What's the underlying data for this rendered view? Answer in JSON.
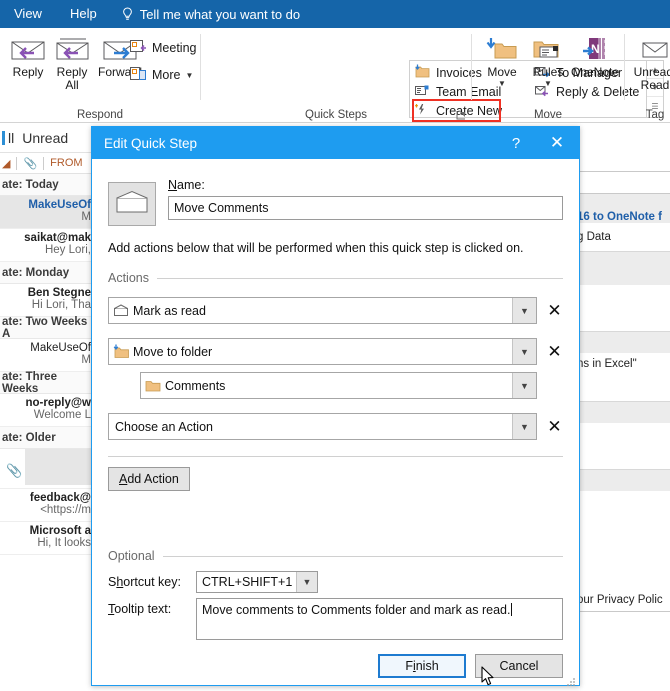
{
  "ribbon": {
    "tabs": [
      {
        "label": "View"
      },
      {
        "label": "Help"
      }
    ],
    "tellme": {
      "icon": "lightbulb-icon",
      "label": "Tell me what you want to do"
    },
    "groups": [
      {
        "name": "Respond",
        "label": "Respond"
      },
      {
        "name": "Quick Steps",
        "label": "Quick Steps"
      },
      {
        "name": "Move",
        "label": "Move"
      },
      {
        "name": "Tags",
        "label": "Tag"
      }
    ],
    "respond": {
      "reply": "Reply",
      "reply_all_line1": "Reply",
      "reply_all_line2": "All",
      "forward": "Forward",
      "meeting": "Meeting",
      "more": "More"
    },
    "quick_steps": {
      "items": [
        {
          "label": "Invoices",
          "icon": "move-folder-icon"
        },
        {
          "label": "To Manager",
          "icon": "forward-mail-icon"
        },
        {
          "label": "Team Email",
          "icon": "new-email-icon"
        },
        {
          "label": "Reply & Delete",
          "icon": "reply-delete-icon"
        },
        {
          "label": "Create New",
          "icon": "create-new-icon"
        }
      ],
      "highlighted": "Create New"
    },
    "move": {
      "move": "Move",
      "rules": "Rules",
      "onenote": "OneNote"
    },
    "tags": {
      "unread_line1": "Unread/",
      "unread_line2": "Read"
    }
  },
  "mail_list": {
    "toolbar": {
      "all": "ll",
      "unread": "Unread"
    },
    "columns": {
      "from": "FROM",
      "attachment_icon": "paperclip-icon",
      "sort_icon": "sort-icon"
    },
    "groups": [
      {
        "header": "ate: Today",
        "rows": [
          {
            "from": "MakeUseOf",
            "preview": "M",
            "selected": true,
            "blue": true
          },
          {
            "from": "saikat@mak",
            "preview": "Hey Lori,",
            "selected": false,
            "blue": false
          }
        ]
      },
      {
        "header": "ate: Monday",
        "rows": [
          {
            "from": "Ben Stegne",
            "preview": "Hi Lori,  Tha",
            "selected": false,
            "blue": false
          }
        ]
      },
      {
        "header": "ate: Two Weeks A",
        "rows": [
          {
            "from": "MakeUseOf",
            "preview": "M",
            "selected": false,
            "blue": false
          }
        ]
      },
      {
        "header": "ate: Three Weeks",
        "rows": [
          {
            "from": "no-reply@w",
            "preview": "Welcome L",
            "selected": false,
            "blue": false
          }
        ]
      },
      {
        "header": "ate: Older",
        "rows": [
          {
            "from": "feedback@",
            "preview": "<https://m",
            "selected": false,
            "blue": false
          },
          {
            "from": "Microsoft a",
            "preview": "Hi,  It looks",
            "selected": false,
            "blue": false
          }
        ]
      }
    ]
  },
  "reading_pane": {
    "lines": [
      {
        "text": "16 to OneNote f",
        "blue": true
      },
      {
        "text": "g Data",
        "blue": false
      },
      {
        "text": "ns in Excel\"",
        "blue": false
      },
      {
        "text": "our Privacy Polic",
        "blue": false
      }
    ]
  },
  "dialog": {
    "title": "Edit Quick Step",
    "help_button": "?",
    "close_button": "✕",
    "icon": "envelope-icon",
    "name_label": "Name:",
    "name_value": "Move Comments",
    "hint": "Add actions below that will be performed when this quick step is clicked on.",
    "actions_legend": "Actions",
    "actions": [
      {
        "label": "Mark as read",
        "icon": "mark-read-icon",
        "has_remove": true,
        "sub": null
      },
      {
        "label": "Move to folder",
        "icon": "move-folder-icon",
        "has_remove": true,
        "sub": {
          "label": "Comments",
          "icon": "folder-icon"
        }
      },
      {
        "label": "Choose an Action",
        "icon": null,
        "has_remove": true,
        "sub": null
      }
    ],
    "add_action_button": "Add Action",
    "optional_legend": "Optional",
    "shortcut_label": "Shortcut key:",
    "shortcut_value": "CTRL+SHIFT+1",
    "tooltip_label": "Tooltip text:",
    "tooltip_value": "Move comments to Comments folder and mark as read.",
    "finish_button": "Finish",
    "cancel_button": "Cancel"
  },
  "colors": {
    "ribbon_tab_blue": "#1565a9",
    "dialog_title_blue": "#1e9cf0",
    "highlight_red": "#ef3124",
    "folder_tan": "#f0c080",
    "accent_purple": "#8a52b5",
    "accent_blue": "#2d7dd2",
    "onenote_purple": "#80397b"
  }
}
